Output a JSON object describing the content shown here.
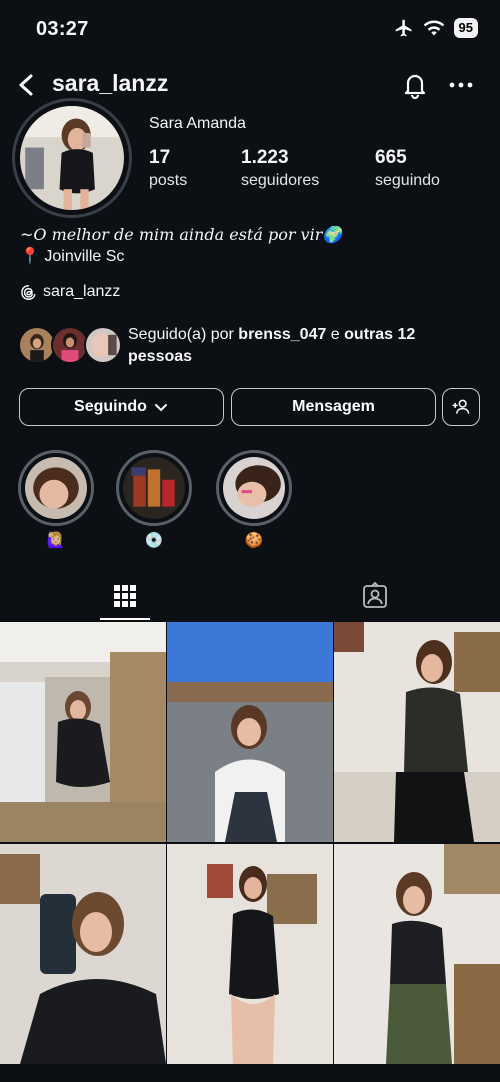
{
  "status": {
    "time": "03:27",
    "battery": "95"
  },
  "nav": {
    "username": "sara_lanzz"
  },
  "profile": {
    "name": "Sara Amanda",
    "posts_count": "17",
    "posts_label": "posts",
    "followers_count": "1.223",
    "followers_label": "seguidores",
    "following_count": "665",
    "following_label": "seguindo",
    "bio_line1": "~O melhor de mim ainda está por vir🌍",
    "bio_line2": "📍 Joinville Sc",
    "threads_handle": "sara_lanzz"
  },
  "followed_by": {
    "prefix": "Seguido(a) por ",
    "user": "brenss_047",
    "middle": " e ",
    "others": "outras 12 pessoas"
  },
  "actions": {
    "following_label": "Seguindo",
    "message_label": "Mensagem"
  },
  "highlights": [
    {
      "label": "🙋🏼‍♀️"
    },
    {
      "label": "💿"
    },
    {
      "label": "🍪"
    }
  ],
  "icons": {
    "back": "chevron-left-icon",
    "bell": "bell-icon",
    "more": "more-horizontal-icon",
    "threads": "threads-icon",
    "add_person": "add-person-icon",
    "grid_tab": "grid-icon",
    "tagged_tab": "tagged-person-icon"
  },
  "colors": {
    "background": "#0c0f14",
    "text": "#f5f5f5",
    "border": "#c9c9c9"
  }
}
